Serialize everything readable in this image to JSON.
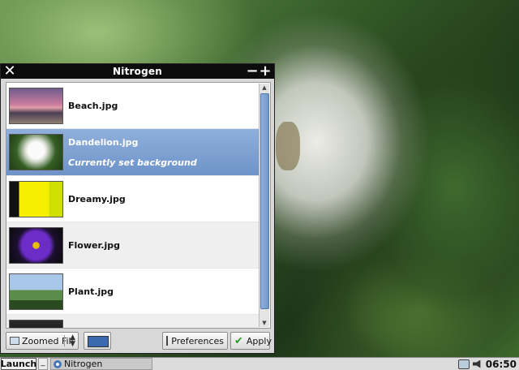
{
  "window": {
    "title": "Nitrogen",
    "close_icon": "close-icon",
    "minimize_icon": "minimize-icon",
    "maximize_icon": "maximize-icon"
  },
  "wallpapers": [
    {
      "name": "Beach.jpg",
      "thumb": "beach"
    },
    {
      "name": "Dandelion.jpg",
      "thumb": "dandelion",
      "selected": true,
      "status": "Currently set background"
    },
    {
      "name": "Dreamy.jpg",
      "thumb": "dreamy"
    },
    {
      "name": "Flower.jpg",
      "thumb": "flower"
    },
    {
      "name": "Plant.jpg",
      "thumb": "plant"
    }
  ],
  "controls": {
    "mode": "Zoomed Fill",
    "bg_color": "#3b6ab0",
    "preferences_label": "Preferences",
    "apply_label": "Apply"
  },
  "taskbar": {
    "launch_label": "Launch",
    "show_desktop": "_",
    "task_label": "Nitrogen",
    "clock": "06:50"
  }
}
